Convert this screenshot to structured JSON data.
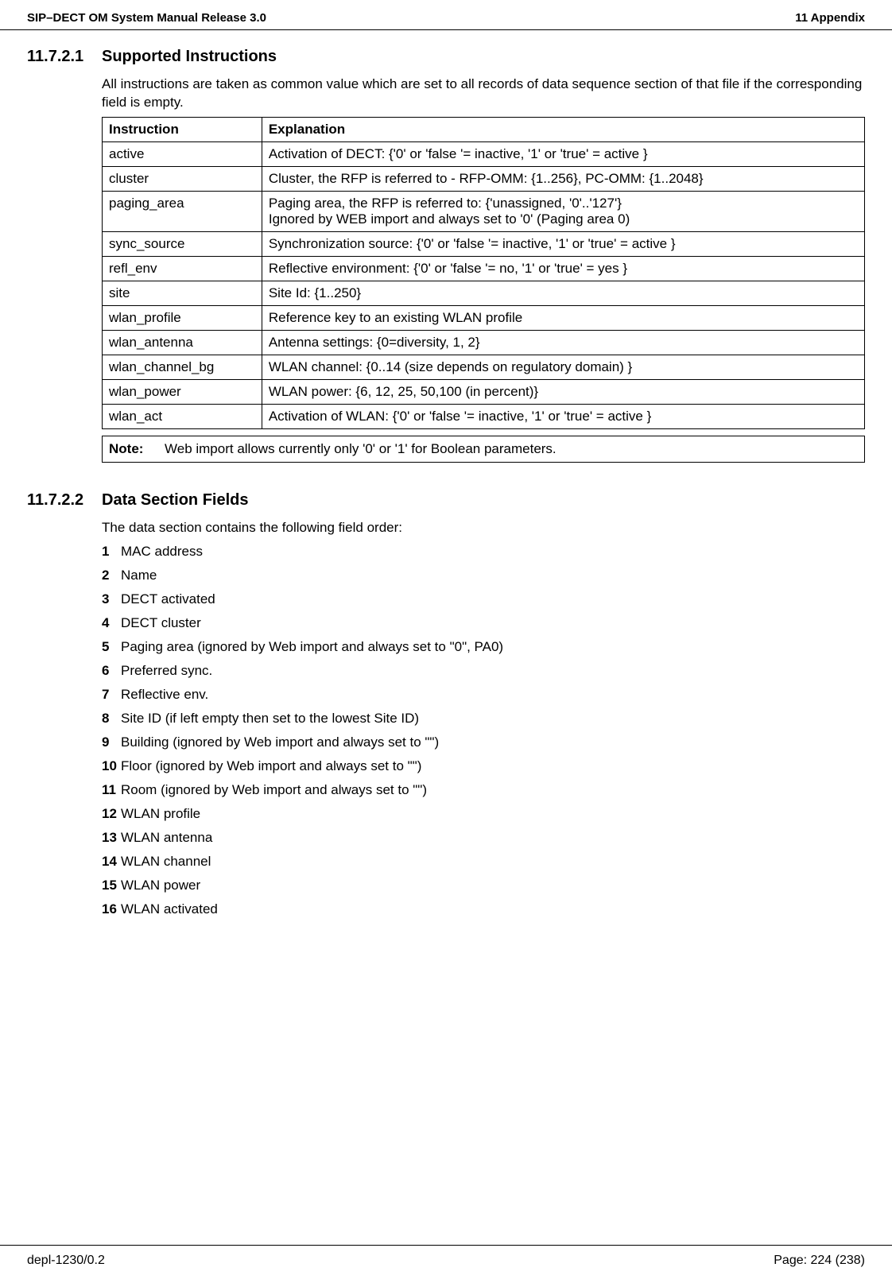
{
  "header": {
    "left": "SIP–DECT OM System Manual Release 3.0",
    "right": "11 Appendix"
  },
  "section1": {
    "number": "11.7.2.1",
    "title": "Supported Instructions",
    "intro": "All instructions are taken as common value which are set to all records of data sequence section of that file if the corresponding field is empty.",
    "th1": "Instruction",
    "th2": "Explanation",
    "rows": [
      {
        "c0": "active",
        "c1": "Activation of DECT: {'0' or 'false '= inactive, '1' or 'true' = active }"
      },
      {
        "c0": "cluster",
        "c1": "Cluster, the RFP is referred to - RFP-OMM: {1..256}, PC-OMM: {1..2048}"
      },
      {
        "c0": "paging_area",
        "c1": "Paging area, the RFP is referred to: {'unassigned, '0'..'127'}\nIgnored by WEB import and always set to '0' (Paging area 0)"
      },
      {
        "c0": "sync_source",
        "c1": "Synchronization source: {'0' or 'false '= inactive, '1' or 'true' = active }"
      },
      {
        "c0": "refl_env",
        "c1": "Reflective environment: {'0' or 'false '= no, '1' or 'true' = yes }"
      },
      {
        "c0": "site",
        "c1": "Site Id: {1..250}"
      },
      {
        "c0": "wlan_profile",
        "c1": "Reference key to an existing WLAN profile"
      },
      {
        "c0": "wlan_antenna",
        "c1": "Antenna settings: {0=diversity, 1, 2}"
      },
      {
        "c0": "wlan_channel_bg",
        "c1": "WLAN channel: {0..14 (size depends on regulatory domain) }"
      },
      {
        "c0": "wlan_power",
        "c1": "WLAN power: {6, 12, 25, 50,100 (in percent)}"
      },
      {
        "c0": "wlan_act",
        "c1": "Activation of WLAN: {'0' or 'false '= inactive, '1' or 'true' = active }"
      }
    ],
    "note_label": "Note:",
    "note_text": "Web import allows currently only '0' or '1' for Boolean parameters."
  },
  "section2": {
    "number": "11.7.2.2",
    "title": "Data Section Fields",
    "intro": "The data section contains the following field order:",
    "items": [
      "MAC address",
      "Name",
      "DECT activated",
      "DECT cluster",
      "Paging area (ignored by Web import and always set to \"0\", PA0)",
      "Preferred sync.",
      "Reflective env.",
      "Site ID (if left empty then set to the lowest Site ID)",
      "Building (ignored by Web import and always set to \"\")",
      "Floor (ignored by Web import and always set to \"\")",
      "Room (ignored by Web import and always set to \"\")",
      "WLAN profile",
      "WLAN antenna",
      "WLAN channel",
      "WLAN power",
      "WLAN activated"
    ]
  },
  "footer": {
    "left": "depl-1230/0.2",
    "right": "Page: 224 (238)"
  }
}
